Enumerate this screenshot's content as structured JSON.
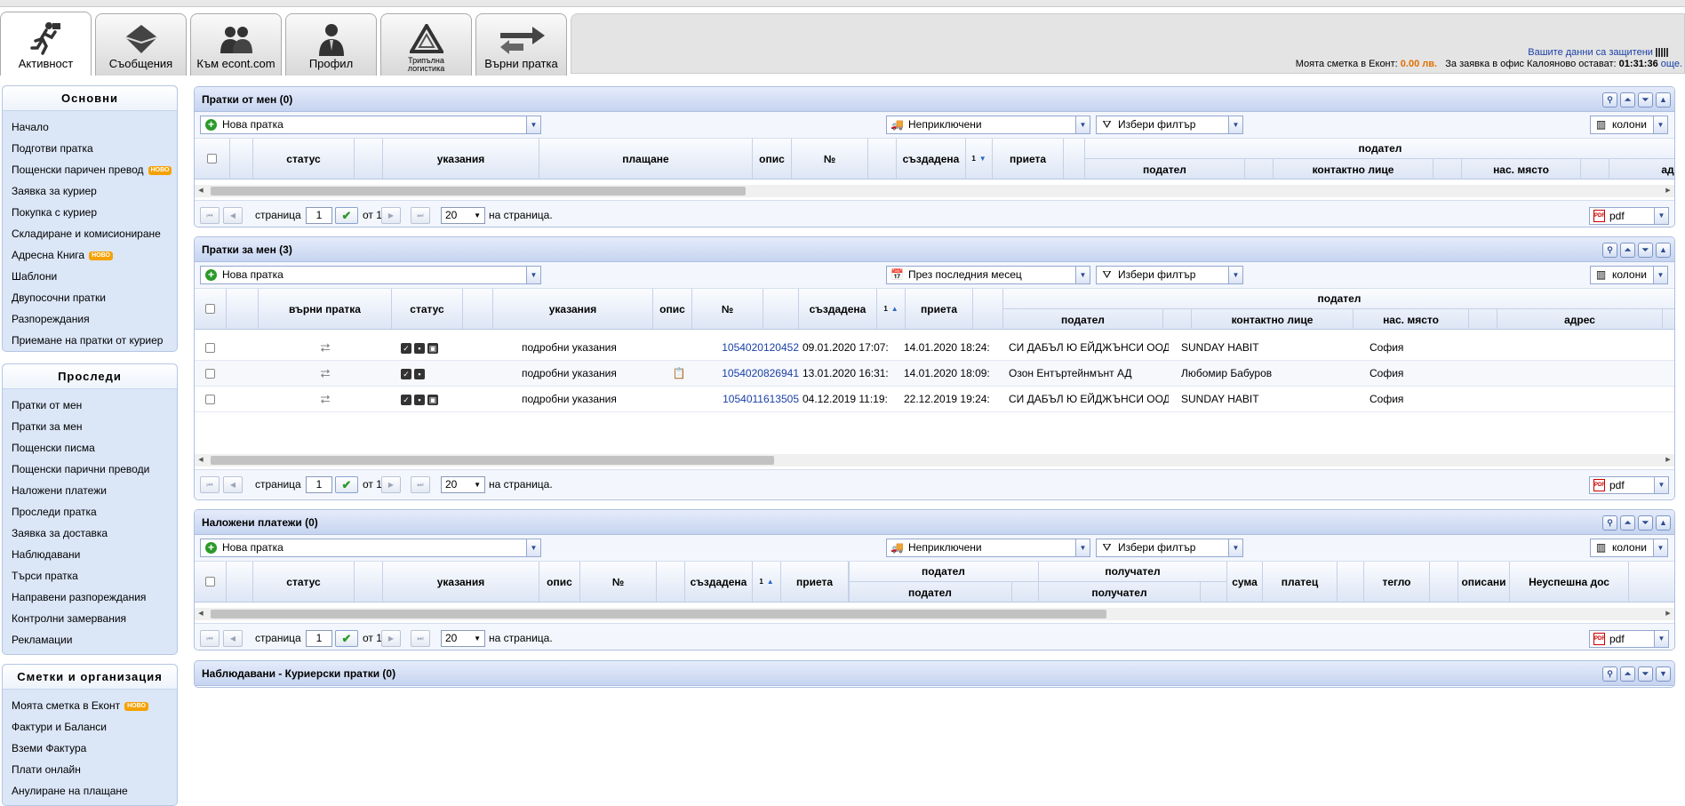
{
  "tabs": [
    {
      "label": "Активност",
      "icon": "running-man-icon"
    },
    {
      "label": "Съобщения",
      "icon": "envelope-icon"
    },
    {
      "label": "Към econt.com",
      "icon": "people-icon"
    },
    {
      "label": "Профил",
      "icon": "profile-person-icon"
    },
    {
      "label": "Трипълна логистика",
      "icon": "recycle-triangle-icon"
    },
    {
      "label": "Върни пратка",
      "icon": "return-arrows-icon"
    }
  ],
  "header": {
    "secure_text": "Вашите данни са защитени",
    "account_label": "Моята сметка в Еконт:",
    "account_value": "0.00 лв.",
    "request_label": "За заявка в офис Калояново остават:",
    "request_time": "01:31:36",
    "more": "още."
  },
  "sidebar": [
    {
      "title": "Основни",
      "items": [
        {
          "label": "Начало"
        },
        {
          "label": "Подготви пратка"
        },
        {
          "label": "Пощенски паричен превод",
          "badge": "НОВО"
        },
        {
          "label": "Заявка за куриер"
        },
        {
          "label": "Покупка с куриер"
        },
        {
          "label": "Складиране и комисиониране"
        },
        {
          "label": "Адресна Книга",
          "badge": "НОВО"
        },
        {
          "label": "Шаблони"
        },
        {
          "label": "Двупосочни пратки"
        },
        {
          "label": "Разпореждания"
        },
        {
          "label": "Приемане на пратки от куриер"
        }
      ]
    },
    {
      "title": "Проследи",
      "items": [
        {
          "label": "Пратки от мен"
        },
        {
          "label": "Пратки за мен"
        },
        {
          "label": "Пощенски писма"
        },
        {
          "label": "Пощенски парични преводи"
        },
        {
          "label": "Наложени платежи"
        },
        {
          "label": "Проследи пратка"
        },
        {
          "label": "Заявка за доставка"
        },
        {
          "label": "Наблюдавани"
        },
        {
          "label": "Търси пратка"
        },
        {
          "label": "Направени разпореждания"
        },
        {
          "label": "Контролни замервания"
        },
        {
          "label": "Рекламации"
        }
      ]
    },
    {
      "title": "Сметки и организация",
      "items": [
        {
          "label": "Моята сметка в Еконт",
          "badge": "НОВО"
        },
        {
          "label": "Фактури и Баланси"
        },
        {
          "label": "Вземи Фактура"
        },
        {
          "label": "Плати онлайн"
        },
        {
          "label": "Анулиране на плащане"
        }
      ]
    }
  ],
  "common": {
    "new_shipment": "Нова пратка",
    "filter": "Избери филтър",
    "columns": "колони",
    "page": "страница",
    "page_value": "1",
    "of": "от 1",
    "per_page_value": "20",
    "per_page": "на страница.",
    "pdf": "pdf",
    "sort_index": "1"
  },
  "panel1": {
    "title": "Пратки от мен (0)",
    "status_filter": "Неприключени",
    "headers": {
      "status": "статус",
      "instructions": "указания",
      "payment": "плащане",
      "desc": "опис",
      "num": "№",
      "created": "създадена",
      "received": "приета",
      "sender_group": "подател",
      "sender": "подател",
      "contact": "контактно лице",
      "place": "нас. място",
      "addr": "адр"
    }
  },
  "panel2": {
    "title": "Пратки за мен (3)",
    "status_filter": "През последния месец",
    "headers": {
      "return": "върни пратка",
      "status": "статус",
      "instructions": "указания",
      "desc": "опис",
      "num": "№",
      "created": "създадена",
      "received": "приета",
      "sender_group": "подател",
      "sender": "подател",
      "contact": "контактно лице",
      "place": "нас. място",
      "addr": "адрес"
    },
    "rows": [
      {
        "instructions": "подробни указания",
        "num": "1054020120452",
        "created": "09.01.2020 17:07:",
        "received": "14.01.2020 18:24:",
        "sender": "СИ ДАБЪЛ Ю ЕЙДЖЪНСИ ООД",
        "contact": "SUNDAY HABIT",
        "place": "София",
        "desc_icon": ""
      },
      {
        "instructions": "подробни указания",
        "num": "1054020826941",
        "created": "13.01.2020 16:31:",
        "received": "14.01.2020 18:09:",
        "sender": "Озон Ентъртейнмънт АД",
        "contact": "Любомир Бабуров",
        "place": "София",
        "desc_icon": "clipboard-icon"
      },
      {
        "instructions": "подробни указания",
        "num": "1054011613505",
        "created": "04.12.2019 11:19:",
        "received": "22.12.2019 19:24:",
        "sender": "СИ ДАБЪЛ Ю ЕЙДЖЪНСИ ООД",
        "contact": "SUNDAY HABIT",
        "place": "София",
        "desc_icon": ""
      }
    ]
  },
  "panel3": {
    "title": "Наложени платежи (0)",
    "status_filter": "Неприключени",
    "headers": {
      "status": "статус",
      "instructions": "указания",
      "desc": "опис",
      "num": "№",
      "created": "създадена",
      "received": "приета",
      "sender_group": "подател",
      "receiver_group": "получател",
      "sender": "подател",
      "receiver": "получател",
      "amount": "сума",
      "payer": "платец",
      "weight": "тегло",
      "description": "описани",
      "failed": "Неуспешна дос"
    }
  },
  "panel4": {
    "title": "Наблюдавани - Куриерски пратки (0)"
  }
}
